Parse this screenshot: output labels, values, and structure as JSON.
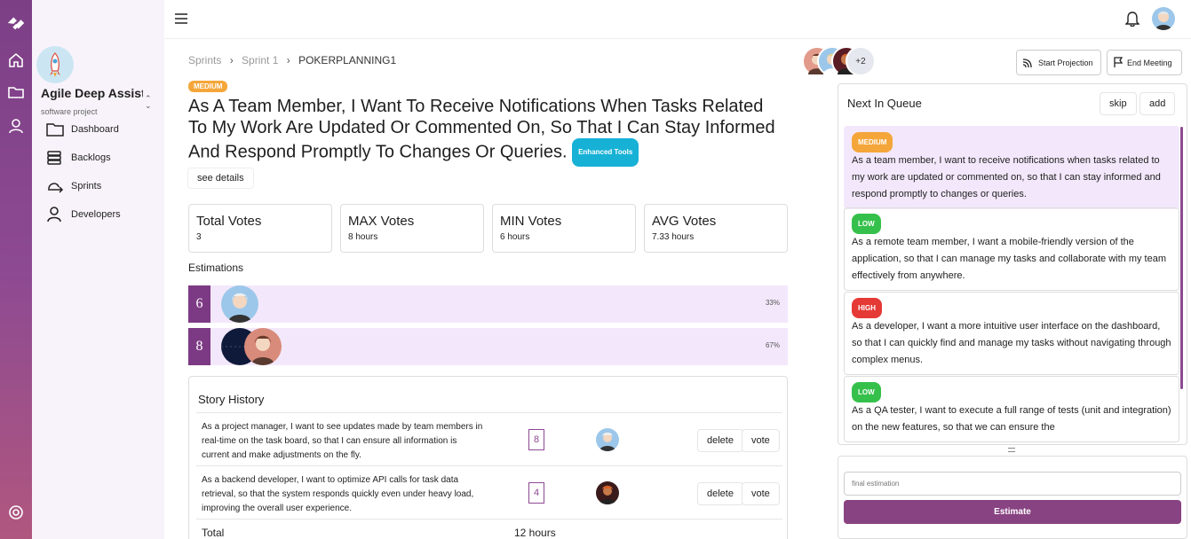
{
  "sidebar": {
    "project_name": "Agile Deep Assist...",
    "project_type": "software project",
    "items": [
      {
        "label": "Dashboard",
        "icon": "folder-icon"
      },
      {
        "label": "Backlogs",
        "icon": "stack-icon"
      },
      {
        "label": "Sprints",
        "icon": "sprint-arrow-icon"
      },
      {
        "label": "Developers",
        "icon": "user-icon"
      }
    ]
  },
  "breadcrumb": {
    "level1": "Sprints",
    "level2": "Sprint 1",
    "current": "POKERPLANNING1"
  },
  "participants": {
    "more": "+2"
  },
  "header_actions": {
    "start_projection": "Start Projection",
    "end_meeting": "End Meeting"
  },
  "story": {
    "priority": "MEDIUM",
    "title": "As A Team Member, I Want To Receive Notifications When Tasks Related To My Work Are Updated Or Commented On, So That I Can Stay Informed And Respond Promptly To Changes Or Queries.",
    "tag": "Enhanced Tools",
    "see_details": "see details"
  },
  "stats": [
    {
      "label": "Total Votes",
      "value": "3"
    },
    {
      "label": "MAX Votes",
      "value": "8 hours"
    },
    {
      "label": "MIN Votes",
      "value": "6 hours"
    },
    {
      "label": "AVG Votes",
      "value": "7.33 hours"
    }
  ],
  "estimations": {
    "heading": "Estimations",
    "rows": [
      {
        "value": "6",
        "percent": "33%"
      },
      {
        "value": "8",
        "percent": "67%"
      }
    ]
  },
  "history": {
    "heading": "Story History",
    "rows": [
      {
        "text": "As a project manager, I want to see updates made by team members in real-time on the task board, so that I can ensure all information is current and make adjustments on the fly.",
        "points": "8",
        "delete": "delete",
        "vote": "vote"
      },
      {
        "text": "As a backend developer, I want to optimize API calls for task data retrieval, so that the system responds quickly even under heavy load, improving the overall user experience.",
        "points": "4",
        "delete": "delete",
        "vote": "vote"
      }
    ],
    "total_label": "Total",
    "total_value": "12 hours"
  },
  "queue": {
    "heading": "Next In Queue",
    "skip": "skip",
    "add": "add",
    "items": [
      {
        "priority": "MEDIUM",
        "color": "#f5a63a",
        "text": "As a team member, I want to receive notifications when tasks related to my work are updated or commented on, so that I can stay informed and respond promptly to changes or queries."
      },
      {
        "priority": "LOW",
        "color": "#35c04b",
        "text": "As a remote team member, I want a mobile-friendly version of the application, so that I can manage my tasks and collaborate with my team effectively from anywhere."
      },
      {
        "priority": "HIGH",
        "color": "#e53935",
        "text": "As a developer, I want a more intuitive user interface on the dashboard, so that I can quickly find and manage my tasks without navigating through complex menus."
      },
      {
        "priority": "LOW",
        "color": "#35c04b",
        "text": "As a QA tester, I want to execute a full range of tests (unit and integration) on the new features, so that we can ensure the"
      }
    ]
  },
  "estimate_panel": {
    "placeholder": "final estimation",
    "button": "Estimate"
  },
  "colors": {
    "accent": "#884382",
    "medium": "#f5a63a",
    "low": "#35c04b",
    "high": "#e53935",
    "tag": "#17b1d6"
  }
}
